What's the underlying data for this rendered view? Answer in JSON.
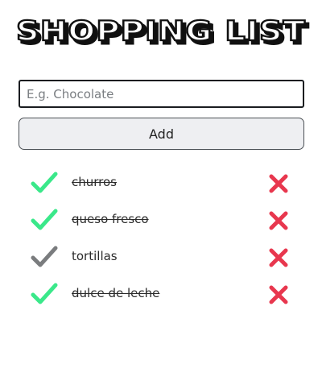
{
  "header": {
    "title": "SHOPPING LIST"
  },
  "form": {
    "placeholder": "E.g. Chocolate",
    "value": "",
    "add_label": "Add"
  },
  "colors": {
    "check_done": "#3ae88a",
    "check_pending": "#7a7c7e",
    "delete": "#e8374e"
  },
  "items": [
    {
      "label": "churros",
      "done": true
    },
    {
      "label": "queso fresco",
      "done": true
    },
    {
      "label": "tortillas",
      "done": false
    },
    {
      "label": "dulce de leche",
      "done": true
    }
  ]
}
